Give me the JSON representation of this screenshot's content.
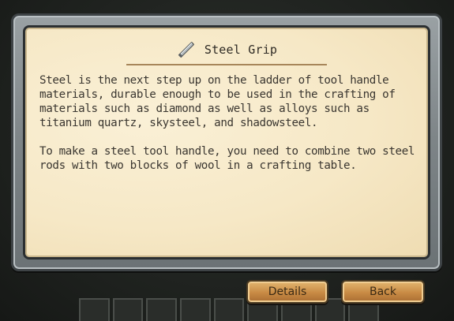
{
  "dialog": {
    "title": "Steel Grip",
    "icon": "tool-handle-icon",
    "paragraphs": [
      "Steel is the next step up on the ladder of tool handle materials, durable enough to be used in the crafting of materials such as diamond as well as alloys such as titanium quartz, skysteel, and shadowsteel.",
      "To make a steel tool handle, you need to combine two steel rods with two blocks of wool in a crafting table."
    ]
  },
  "buttons": {
    "details_label": "Details",
    "back_label": "Back"
  },
  "colors": {
    "parchment": "#f6e8c6",
    "frame": "#8a9194",
    "button": "#c88a44",
    "text": "#3a3630"
  }
}
